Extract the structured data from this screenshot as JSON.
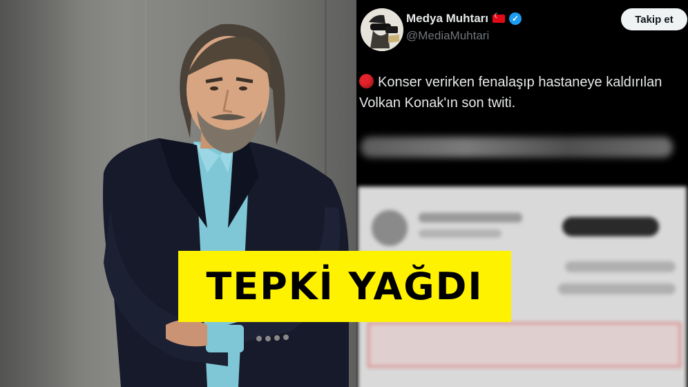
{
  "tweet": {
    "author_name": "Medya Muhtarı",
    "author_handle": "@MediaMuhtari",
    "follow_label": "Takip et",
    "text": "Konser verirken fenalaşıp hastaneye kaldırılan Volkan Konak'ın son twiti.",
    "icons": [
      "turkey-flag-icon",
      "verified-badge-icon",
      "red-circle-icon"
    ]
  },
  "banner": {
    "text": "TEPKİ YAĞDI"
  },
  "colors": {
    "banner_bg": "#fff200",
    "verified": "#1d9bf0",
    "follow_bg": "#eff3f4"
  }
}
